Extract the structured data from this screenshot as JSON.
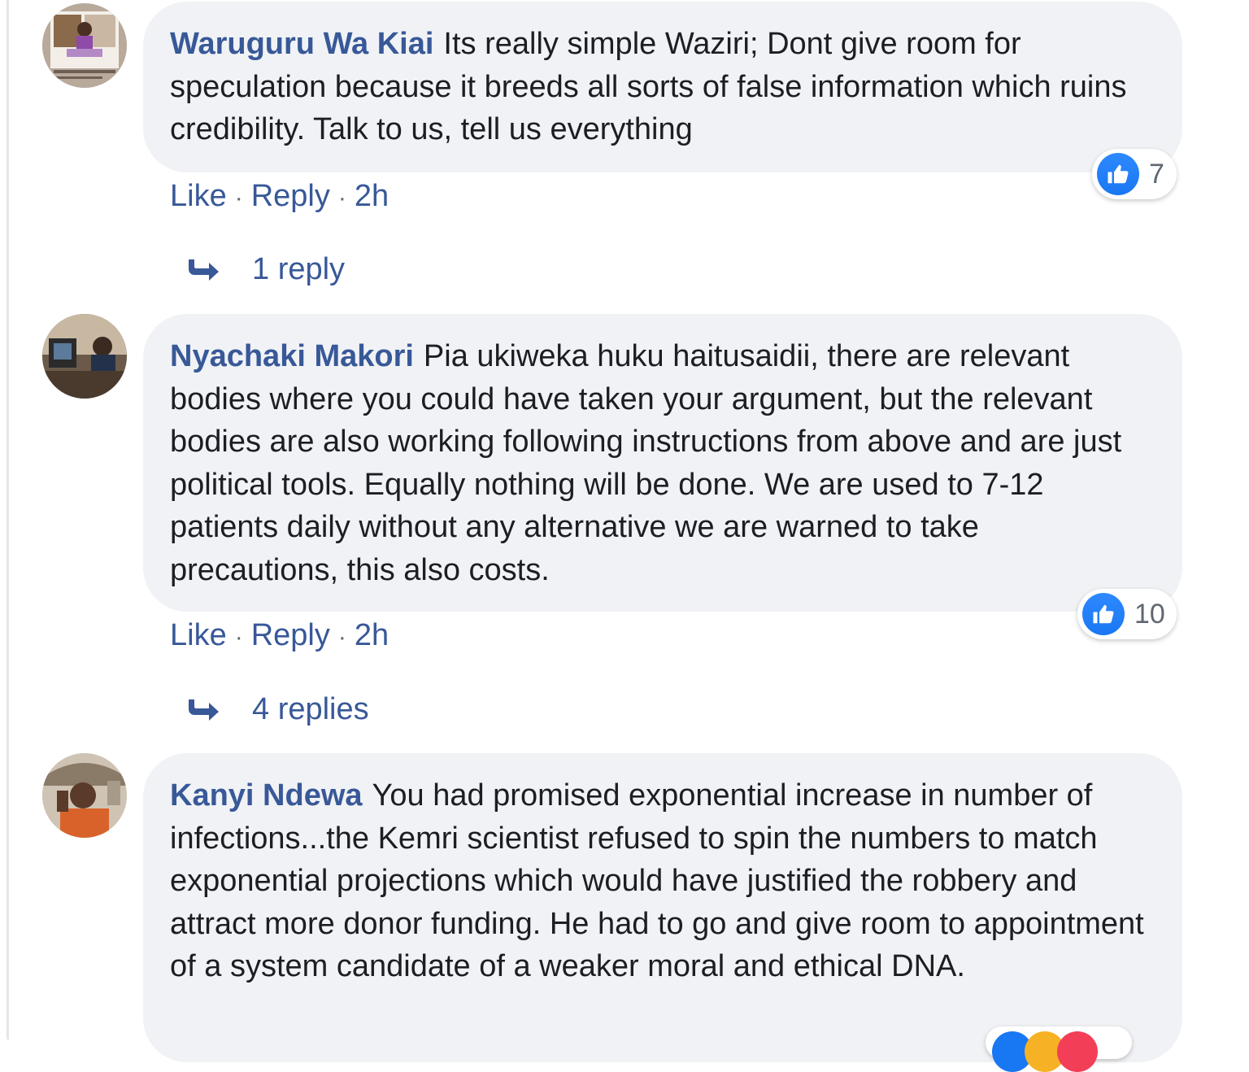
{
  "comments": [
    {
      "author": "Waruguru Wa Kiai",
      "text": "Its really simple Waziri; Dont give room for speculation because it breeds all sorts of false information which ruins credibility. Talk to us, tell us everything",
      "reaction_count": "7",
      "actions": {
        "like": "Like",
        "reply": "Reply",
        "time": "2h"
      },
      "replies_label": "1 reply"
    },
    {
      "author": "Nyachaki Makori",
      "text": "Pia ukiweka huku haitusaidii, there are relevant bodies where you could have taken your argument, but the relevant bodies are also working following instructions from above and are just political tools. Equally nothing will be done. We are used to 7-12 patients daily without any alternative we are warned to take precautions, this also costs.",
      "reaction_count": "10",
      "actions": {
        "like": "Like",
        "reply": "Reply",
        "time": "2h"
      },
      "replies_label": "4 replies"
    },
    {
      "author": "Kanyi Ndewa",
      "text": "You had promised exponential increase in number of infections...the Kemri scientist refused to spin the numbers to match exponential projections which would have justified the robbery and attract more donor funding. He had to go and give room to appointment of a system candidate of a weaker moral and ethical DNA."
    }
  ],
  "separator": "·",
  "colors": {
    "link": "#385898",
    "bubble": "#f0f2f5",
    "like_blue": "#1877f2"
  },
  "icons": {
    "reaction": "thumbs-up-icon",
    "reply_arrow": "reply-arrow-icon"
  }
}
